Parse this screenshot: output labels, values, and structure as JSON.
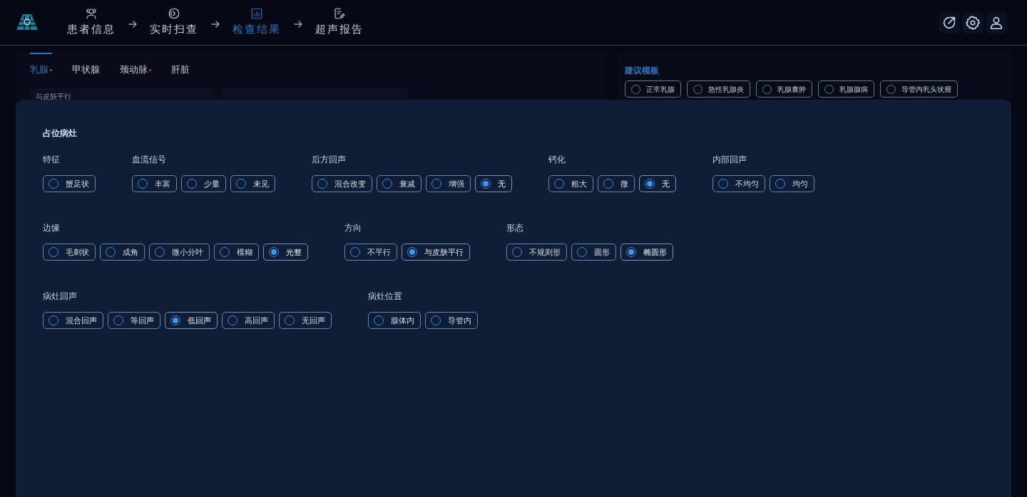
{
  "steps": [
    {
      "label": "患者信息",
      "kind": "users",
      "selected": false
    },
    {
      "label": "实时扫查",
      "kind": "scan",
      "selected": false
    },
    {
      "label": "检查结果",
      "kind": "chart",
      "selected": true
    },
    {
      "label": "超声报告",
      "kind": "report",
      "selected": false
    }
  ],
  "header_actions": [
    {
      "kind": "export"
    },
    {
      "kind": "settings"
    },
    {
      "kind": "user"
    }
  ],
  "organ_tabs": [
    {
      "label": "乳腺",
      "selected": true,
      "flagged": true
    },
    {
      "label": "甲状腺",
      "selected": false,
      "flagged": false
    },
    {
      "label": "颈动脉",
      "selected": false,
      "flagged": true
    },
    {
      "label": "肝脏",
      "selected": false,
      "flagged": false
    }
  ],
  "fields": [
    {
      "kind": "text",
      "value": "与皮肤平行"
    },
    {
      "kind": "blank"
    }
  ],
  "templates": {
    "title": "建议模板",
    "items": [
      "正常乳腺",
      "急性乳腺炎",
      "乳腺囊肿",
      "乳腺腺病",
      "导管内乳头状瘤"
    ]
  },
  "lesion_panel": {
    "title": "占位病灶",
    "rows": [
      {
        "groups": [
          {
            "label": "特征",
            "options": [
              {
                "label": "蟹足状",
                "selected": false
              }
            ]
          },
          {
            "label": "血流信号",
            "options": [
              {
                "label": "丰富",
                "selected": false
              },
              {
                "label": "少量",
                "selected": false
              },
              {
                "label": "未见",
                "selected": false
              }
            ]
          },
          {
            "label": "后方回声",
            "options": [
              {
                "label": "混合改变",
                "selected": false
              },
              {
                "label": "衰减",
                "selected": false
              },
              {
                "label": "增强",
                "selected": false
              },
              {
                "label": "无",
                "selected": true
              }
            ]
          },
          {
            "label": "钙化",
            "options": [
              {
                "label": "粗大",
                "selected": false
              },
              {
                "label": "微",
                "selected": false
              },
              {
                "label": "无",
                "selected": true
              }
            ]
          },
          {
            "label": "内部回声",
            "options": [
              {
                "label": "不均匀",
                "selected": false
              },
              {
                "label": "均匀",
                "selected": false
              }
            ]
          }
        ]
      },
      {
        "groups": [
          {
            "label": "边缘",
            "options": [
              {
                "label": "毛刺状",
                "selected": false
              },
              {
                "label": "成角",
                "selected": false
              },
              {
                "label": "微小分叶",
                "selected": false
              },
              {
                "label": "模糊",
                "selected": false
              },
              {
                "label": "光整",
                "selected": true
              }
            ]
          },
          {
            "label": "方向",
            "options": [
              {
                "label": "不平行",
                "selected": false
              },
              {
                "label": "与皮肤平行",
                "selected": true
              }
            ]
          },
          {
            "label": "形态",
            "options": [
              {
                "label": "不规则形",
                "selected": false
              },
              {
                "label": "圆形",
                "selected": false
              },
              {
                "label": "椭圆形",
                "selected": true
              }
            ]
          }
        ]
      },
      {
        "groups": [
          {
            "label": "病灶回声",
            "options": [
              {
                "label": "混合回声",
                "selected": false
              },
              {
                "label": "等回声",
                "selected": false
              },
              {
                "label": "低回声",
                "selected": true
              },
              {
                "label": "高回声",
                "selected": false
              },
              {
                "label": "无回声",
                "selected": false
              }
            ]
          },
          {
            "label": "病灶位置",
            "options": [
              {
                "label": "腺体内",
                "selected": false
              },
              {
                "label": "导管内",
                "selected": false
              }
            ]
          }
        ]
      }
    ]
  }
}
